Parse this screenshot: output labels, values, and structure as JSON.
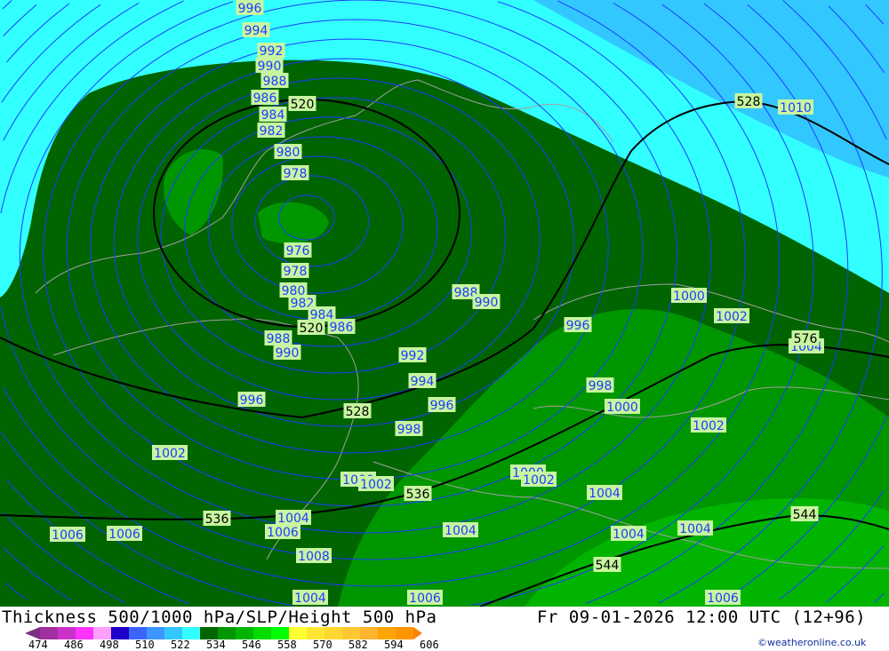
{
  "title": "Thickness 500/1000 hPa/SLP/Height 500 hPa",
  "valid_time": "Fr 09-01-2026 12:00 UTC (12+96)",
  "credit": "©weatheronline.co.uk",
  "colors": {
    "cyan": "#32ffff",
    "blue": "#32c8ff",
    "dark_green": "#006400",
    "green": "#009600",
    "bright_green": "#00b400",
    "isobar": "#1e3cff",
    "thickness_line": "#000000",
    "label_bg": "#c8f5a0",
    "coast": "#a0a0a0"
  },
  "legend": {
    "colors": [
      "#a030a0",
      "#c832c8",
      "#ff32ff",
      "#ffa0ff",
      "#1e00c8",
      "#3c64ff",
      "#3c96ff",
      "#32c8ff",
      "#32ffff",
      "#006400",
      "#009600",
      "#00b400",
      "#00dc00",
      "#00ff00",
      "#ffff32",
      "#ffe632",
      "#ffd732",
      "#ffc832",
      "#ffb432",
      "#ffa500",
      "#ff9600"
    ],
    "arrow_left": "#7a3080",
    "arrow_right": "#ff8200",
    "ticks": [
      "474",
      "486",
      "498",
      "510",
      "522",
      "534",
      "546",
      "558",
      "570",
      "582",
      "594",
      "606"
    ]
  },
  "isobar_labels": [
    "996",
    "994",
    "992",
    "990",
    "988",
    "986",
    "984",
    "982",
    "980",
    "978",
    "976",
    "978",
    "980",
    "982",
    "984",
    "986",
    "988",
    "990",
    "988",
    "990",
    "992",
    "994",
    "996",
    "998",
    "996",
    "1002",
    "1000",
    "1002",
    "1000",
    "1002",
    "1004",
    "1004",
    "1004",
    "1006",
    "1004",
    "1008",
    "1006",
    "1006",
    "1006",
    "1004",
    "1004",
    "1006",
    "1010",
    "1000",
    "1002",
    "996",
    "998",
    "1000",
    "1002",
    "1004"
  ],
  "thickness_labels": [
    "520",
    "520",
    "528",
    "536",
    "536",
    "544",
    "544",
    "528",
    "576"
  ]
}
